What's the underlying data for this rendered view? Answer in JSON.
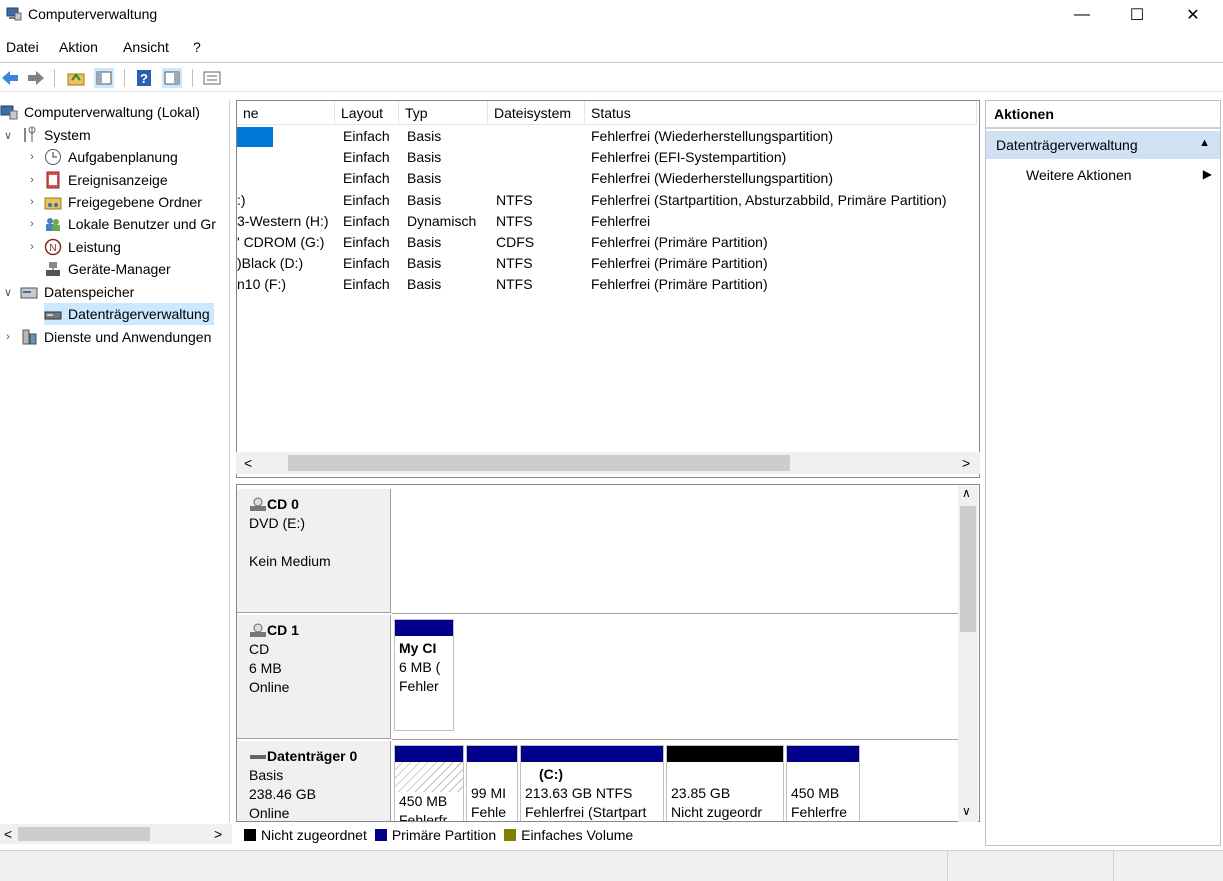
{
  "window": {
    "title": "Computerverwaltung",
    "minimize": "—",
    "maximize": "☐",
    "close": "✕"
  },
  "menu": [
    "Datei",
    "Aktion",
    "Ansicht",
    "?"
  ],
  "tree": {
    "root": "Computerverwaltung (Lokal)",
    "system": "System",
    "aufgabenplanung": "Aufgabenplanung",
    "ereignisanzeige": "Ereignisanzeige",
    "freigegebene": "Freigegebene Ordner",
    "lokale": "Lokale Benutzer und Gr",
    "leistung": "Leistung",
    "geraete": "Geräte-Manager",
    "datenspeicher": "Datenspeicher",
    "datentraeger": "Datenträgerverwaltung",
    "dienste": "Dienste und Anwendungen"
  },
  "list": {
    "columns": [
      "ne",
      "Layout",
      "Typ",
      "Dateisystem",
      "Status"
    ],
    "rows": [
      {
        "name": "",
        "layout": "Einfach",
        "typ": "Basis",
        "fs": "",
        "status": "Fehlerfrei (Wiederherstellungspartition)"
      },
      {
        "name": "",
        "layout": "Einfach",
        "typ": "Basis",
        "fs": "",
        "status": "Fehlerfrei (EFI-Systempartition)"
      },
      {
        "name": "",
        "layout": "Einfach",
        "typ": "Basis",
        "fs": "",
        "status": "Fehlerfrei (Wiederherstellungspartition)"
      },
      {
        "name": ":)",
        "layout": "Einfach",
        "typ": "Basis",
        "fs": "NTFS",
        "status": "Fehlerfrei (Startpartition, Absturzabbild, Primäre Partition)"
      },
      {
        "name": "3-Western (H:)",
        "layout": "Einfach",
        "typ": "Dynamisch",
        "fs": "NTFS",
        "status": "Fehlerfrei"
      },
      {
        "name": "' CDROM (G:)",
        "layout": "Einfach",
        "typ": "Basis",
        "fs": "CDFS",
        "status": "Fehlerfrei (Primäre Partition)"
      },
      {
        "name": ")Black (D:)",
        "layout": "Einfach",
        "typ": "Basis",
        "fs": "NTFS",
        "status": "Fehlerfrei (Primäre Partition)"
      },
      {
        "name": "n10 (F:)",
        "layout": "Einfach",
        "typ": "Basis",
        "fs": "NTFS",
        "status": "Fehlerfrei (Primäre Partition)"
      }
    ]
  },
  "disks": {
    "cd0": {
      "name": "CD 0",
      "line1": "DVD (E:)",
      "line2": "Kein Medium"
    },
    "cd1": {
      "name": "CD 1",
      "line1": "CD",
      "line2": "6 MB",
      "line3": "Online",
      "part": {
        "title": "My CI",
        "size": "6 MB (",
        "status": "Fehler"
      }
    },
    "d0": {
      "name": "Datenträger 0",
      "line1": "Basis",
      "line2": "238.46 GB",
      "line3": "Online",
      "parts": [
        {
          "title": "",
          "size": "450 MB",
          "status": "Fehlerfr"
        },
        {
          "title": "",
          "size": "99 MI",
          "status": "Fehle"
        },
        {
          "title": "(C:)",
          "size": "213.63 GB NTFS",
          "status": "Fehlerfrei (Startpart"
        },
        {
          "title": "",
          "size": "23.85 GB",
          "status": "Nicht zugeordr"
        },
        {
          "title": "",
          "size": "450 MB",
          "status": "Fehlerfre"
        }
      ]
    }
  },
  "legend": [
    {
      "label": "Nicht zugeordnet",
      "color": "#000000"
    },
    {
      "label": "Primäre Partition",
      "color": "#00008b"
    },
    {
      "label": "Einfaches Volume",
      "color": "#808000"
    }
  ],
  "actions": {
    "header": "Aktionen",
    "section": "Datenträgerverwaltung",
    "more": "Weitere Aktionen"
  },
  "colors": {
    "selection": "#0078d7",
    "tree_selection": "#cce8ff",
    "primary_partition": "#00008b",
    "unallocated": "#000000"
  }
}
